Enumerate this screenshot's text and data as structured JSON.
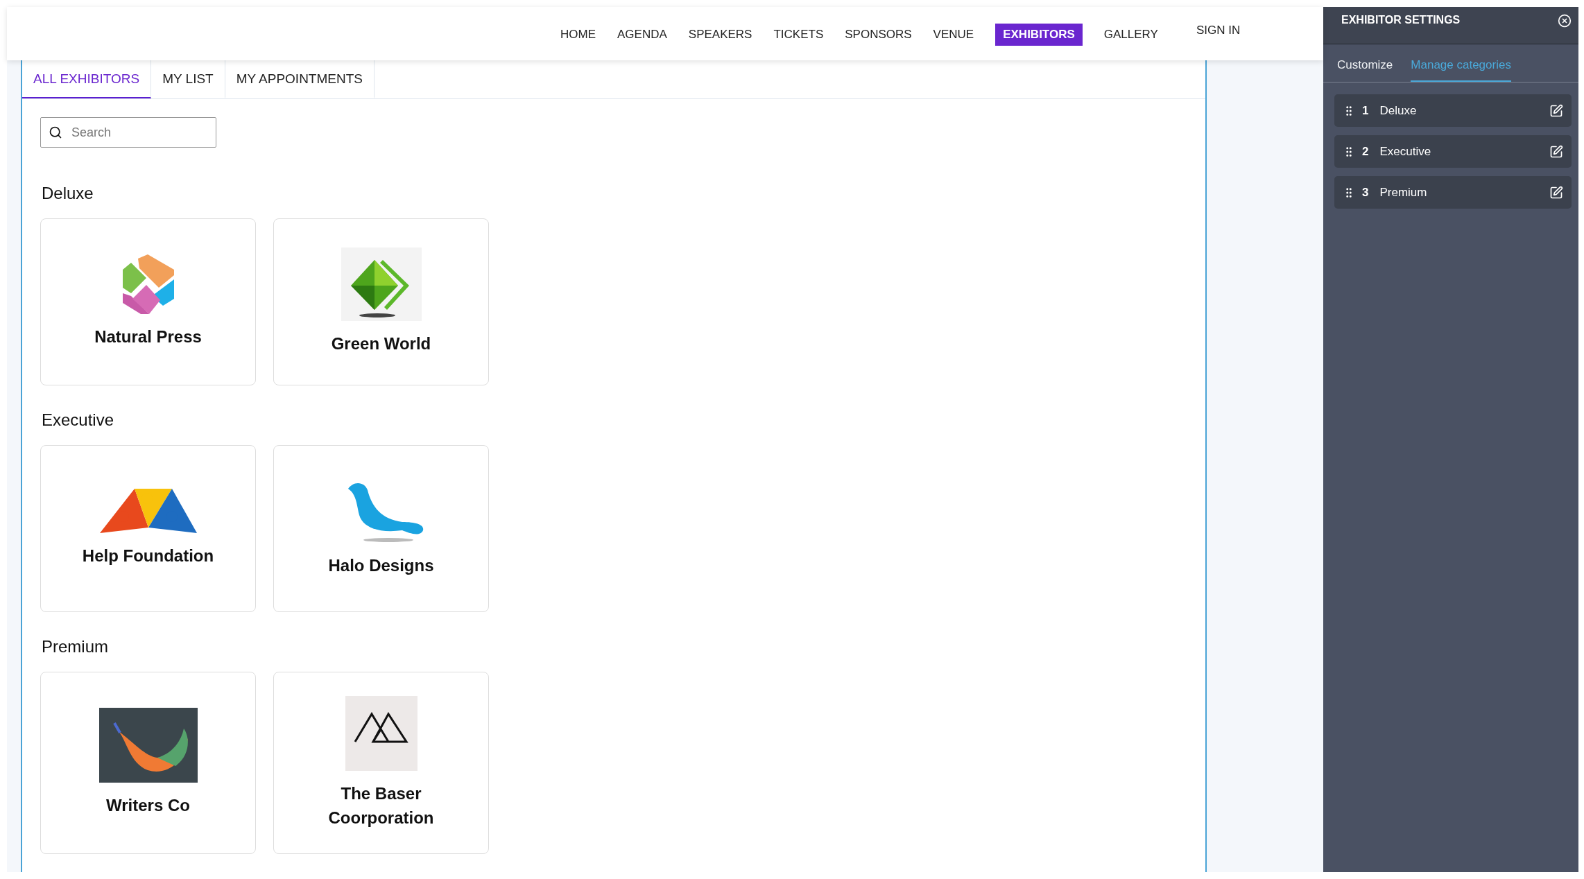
{
  "nav": {
    "items": [
      {
        "label": "HOME",
        "selected": false
      },
      {
        "label": "AGENDA",
        "selected": false
      },
      {
        "label": "SPEAKERS",
        "selected": false
      },
      {
        "label": "TICKETS",
        "selected": false
      },
      {
        "label": "SPONSORS",
        "selected": false
      },
      {
        "label": "VENUE",
        "selected": false
      },
      {
        "label": "EXHIBITORS",
        "selected": true
      },
      {
        "label": "GALLERY",
        "selected": false
      }
    ],
    "sign_in": "SIGN IN"
  },
  "tabs": [
    {
      "label": "ALL EXHIBITORS",
      "selected": true
    },
    {
      "label": "MY LIST",
      "selected": false
    },
    {
      "label": "MY APPOINTMENTS",
      "selected": false
    }
  ],
  "search": {
    "placeholder": "Search"
  },
  "categories": [
    {
      "name": "Deluxe",
      "exhibitors": [
        {
          "name": "Natural Press",
          "kind": "hexagon"
        },
        {
          "name": "Green World",
          "kind": "diamond"
        }
      ]
    },
    {
      "name": "Executive",
      "exhibitors": [
        {
          "name": "Help Foundation",
          "kind": "people"
        },
        {
          "name": "Halo Designs",
          "kind": "bird"
        }
      ]
    },
    {
      "name": "Premium",
      "exhibitors": [
        {
          "name": "Writers Co",
          "kind": "feather"
        },
        {
          "name": "The Baser Coorporation",
          "kind": "mountains"
        }
      ]
    }
  ],
  "panel": {
    "title": "EXHIBITOR SETTINGS",
    "tabs": [
      {
        "label": "Customize",
        "selected": false
      },
      {
        "label": "Manage categories",
        "selected": true
      }
    ],
    "categories": [
      {
        "number": "1",
        "name": "Deluxe"
      },
      {
        "number": "2",
        "name": "Executive"
      },
      {
        "number": "3",
        "name": "Premium"
      }
    ]
  }
}
